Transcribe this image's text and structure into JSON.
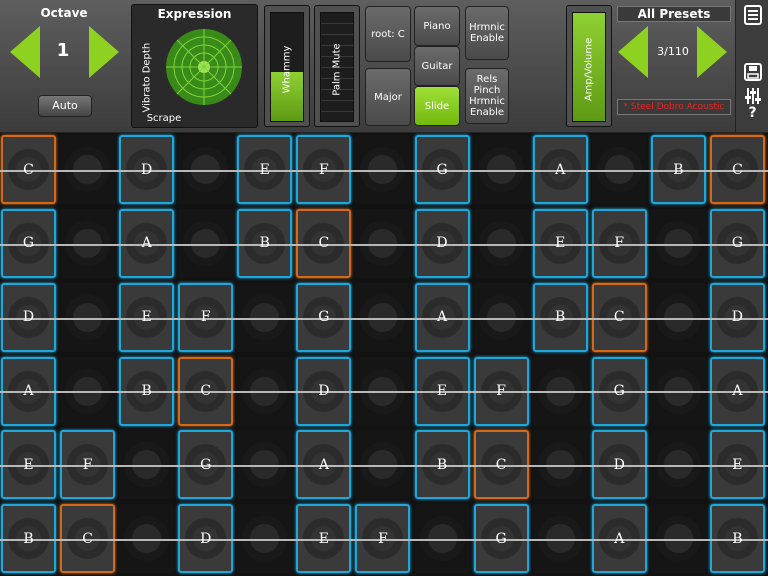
{
  "octave": {
    "title": "Octave",
    "value": "1",
    "auto_label": "Auto"
  },
  "expression": {
    "title": "Expression",
    "vertical_label": "Vibrato Depth",
    "bottom_label": "Scrape"
  },
  "whammy": {
    "label": "Whammy",
    "level": 0.45
  },
  "palm_mute": {
    "label": "Palm Mute",
    "level": 0
  },
  "scale": {
    "root_label": "root: C",
    "mode_label": "Major",
    "instruments": [
      "Piano",
      "Guitar",
      "Slide"
    ],
    "selected_instrument": "Slide",
    "harmonic_enable": "Hrmnic Enable",
    "rels_pinch": "Rels Pinch Hrmnic Enable"
  },
  "amp": {
    "label": "Amp/Volume"
  },
  "presets": {
    "title": "All Presets",
    "counter": "3/110",
    "name": "* Steel Dobro Acoustic"
  },
  "side_icons": [
    "doc-icon",
    "save-icon",
    "sliders-icon",
    "help-icon"
  ],
  "help_label": "?",
  "colors": {
    "accent": "#8ed120",
    "blue": "#1ea7d8",
    "orange": "#d26a1c",
    "preset_red": "#e22222"
  },
  "grid": {
    "rows": [
      [
        "C",
        "",
        "D",
        "",
        "E",
        "F",
        "",
        "G",
        "",
        "A",
        "",
        "B",
        "C"
      ],
      [
        "G",
        "",
        "A",
        "",
        "B",
        "C",
        "",
        "D",
        "",
        "E",
        "F",
        "",
        "G"
      ],
      [
        "D",
        "",
        "E",
        "F",
        "",
        "G",
        "",
        "A",
        "",
        "B",
        "C",
        "",
        "D"
      ],
      [
        "A",
        "",
        "B",
        "C",
        "",
        "D",
        "",
        "E",
        "F",
        "",
        "G",
        "",
        "A"
      ],
      [
        "E",
        "F",
        "",
        "G",
        "",
        "A",
        "",
        "B",
        "C",
        "",
        "D",
        "",
        "E"
      ],
      [
        "B",
        "C",
        "",
        "D",
        "",
        "E",
        "F",
        "",
        "G",
        "",
        "A",
        "",
        "B"
      ]
    ],
    "root_note": "C"
  }
}
